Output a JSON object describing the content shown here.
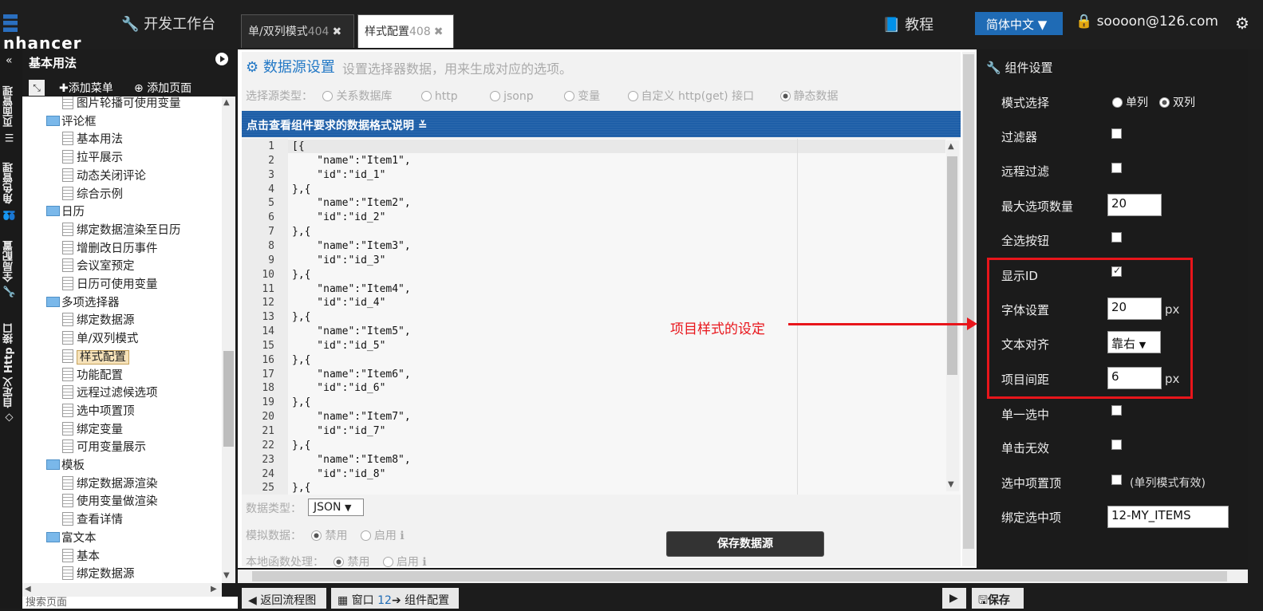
{
  "topbar": {
    "logo": "nhancer",
    "devtool": "开发工作台",
    "tabs": [
      {
        "label": "单/双列模式",
        "num": "404",
        "close": "✖"
      },
      {
        "label": "样式配置",
        "num": "408",
        "close": "✖"
      }
    ],
    "tutorial": "教程",
    "language": "简体中文",
    "user": "soooon@126.com"
  },
  "sidebar": {
    "vertical_tabs": [
      "页面管理",
      "角色管理",
      "全局配置",
      "自定义 Http 接口"
    ],
    "header": "基本用法",
    "add_menu": "添加菜单",
    "add_page": "添加页面",
    "tree": [
      {
        "label": "图片轮播可使用变量",
        "type": "doc",
        "level": 2
      },
      {
        "label": "评论框",
        "type": "folder",
        "level": 1
      },
      {
        "label": "基本用法",
        "type": "doc",
        "level": 2
      },
      {
        "label": "拉平展示",
        "type": "doc",
        "level": 2
      },
      {
        "label": "动态关闭评论",
        "type": "doc",
        "level": 2
      },
      {
        "label": "综合示例",
        "type": "doc",
        "level": 2
      },
      {
        "label": "日历",
        "type": "folder",
        "level": 1
      },
      {
        "label": "绑定数据渲染至日历",
        "type": "doc",
        "level": 2
      },
      {
        "label": "增删改日历事件",
        "type": "doc",
        "level": 2
      },
      {
        "label": "会议室预定",
        "type": "doc",
        "level": 2
      },
      {
        "label": "日历可使用变量",
        "type": "doc",
        "level": 2
      },
      {
        "label": "多项选择器",
        "type": "folder",
        "level": 1
      },
      {
        "label": "绑定数据源",
        "type": "doc",
        "level": 2
      },
      {
        "label": "单/双列模式",
        "type": "doc",
        "level": 2
      },
      {
        "label": "样式配置",
        "type": "doc",
        "level": 2,
        "selected": true
      },
      {
        "label": "功能配置",
        "type": "doc",
        "level": 2
      },
      {
        "label": "远程过滤候选项",
        "type": "doc",
        "level": 2
      },
      {
        "label": "选中项置顶",
        "type": "doc",
        "level": 2
      },
      {
        "label": "绑定变量",
        "type": "doc",
        "level": 2
      },
      {
        "label": "可用变量展示",
        "type": "doc",
        "level": 2
      },
      {
        "label": "模板",
        "type": "folder",
        "level": 1
      },
      {
        "label": "绑定数据源渲染",
        "type": "doc",
        "level": 2
      },
      {
        "label": "使用变量做渲染",
        "type": "doc",
        "level": 2
      },
      {
        "label": "查看详情",
        "type": "doc",
        "level": 2
      },
      {
        "label": "富文本",
        "type": "folder",
        "level": 1
      },
      {
        "label": "基本",
        "type": "doc",
        "level": 2
      },
      {
        "label": "绑定数据源",
        "type": "doc",
        "level": 2
      }
    ],
    "search_placeholder": "搜索页面"
  },
  "datasource": {
    "title": "数据源设置",
    "subtitle": "设置选择器数据，用来生成对应的选项。",
    "source_label": "选择源类型：",
    "source_options": [
      "关系数据库",
      "http",
      "jsonp",
      "变量",
      "自定义 http(get) 接口",
      "静态数据"
    ],
    "source_selected": "静态数据",
    "format_bar": "点击查看组件要求的数据格式说明",
    "code_lines": [
      "[{",
      "    \"name\":\"Item1\",",
      "    \"id\":\"id_1\"",
      "},{",
      "    \"name\":\"Item2\",",
      "    \"id\":\"id_2\"",
      "},{",
      "    \"name\":\"Item3\",",
      "    \"id\":\"id_3\"",
      "},{",
      "    \"name\":\"Item4\",",
      "    \"id\":\"id_4\"",
      "},{",
      "    \"name\":\"Item5\",",
      "    \"id\":\"id_5\"",
      "},{",
      "    \"name\":\"Item6\",",
      "    \"id\":\"id_6\"",
      "},{",
      "    \"name\":\"Item7\",",
      "    \"id\":\"id_7\"",
      "},{",
      "    \"name\":\"Item8\",",
      "    \"id\":\"id_8\"",
      "},{"
    ],
    "data_type_label": "数据类型：",
    "data_type_value": "JSON",
    "mock_label": "模拟数据：",
    "local_label": "本地函数处理：",
    "disabled": "禁用",
    "enabled": "启用",
    "save_button": "保存数据源"
  },
  "bottombar": {
    "back": "返回流程图",
    "window_label": "窗口",
    "window_num": "12",
    "component": "组件配置",
    "save": "保存"
  },
  "component_settings": {
    "title": "组件设置",
    "mode_label": "模式选择",
    "mode_single": "单列",
    "mode_double": "双列",
    "mode_selected": "双列",
    "filter_label": "过滤器",
    "remote_filter_label": "远程过滤",
    "max_items_label": "最大选项数量",
    "max_items_value": "20",
    "select_all_label": "全选按钮",
    "show_id_label": "显示ID",
    "show_id_checked": true,
    "font_label": "字体设置",
    "font_value": "20",
    "font_unit": "px",
    "align_label": "文本对齐",
    "align_value": "靠右",
    "spacing_label": "项目间距",
    "spacing_value": "6",
    "spacing_unit": "px",
    "single_select_label": "单一选中",
    "click_invalid_label": "单击无效",
    "pin_selected_label": "选中项置顶",
    "pin_note": "(单列模式有效)",
    "bind_label": "绑定选中项",
    "bind_value": "12-MY_ITEMS"
  },
  "annotation": "项目样式的设定",
  "colors": {
    "accent": "#1e5fa8",
    "highlight": "#e8151b"
  }
}
